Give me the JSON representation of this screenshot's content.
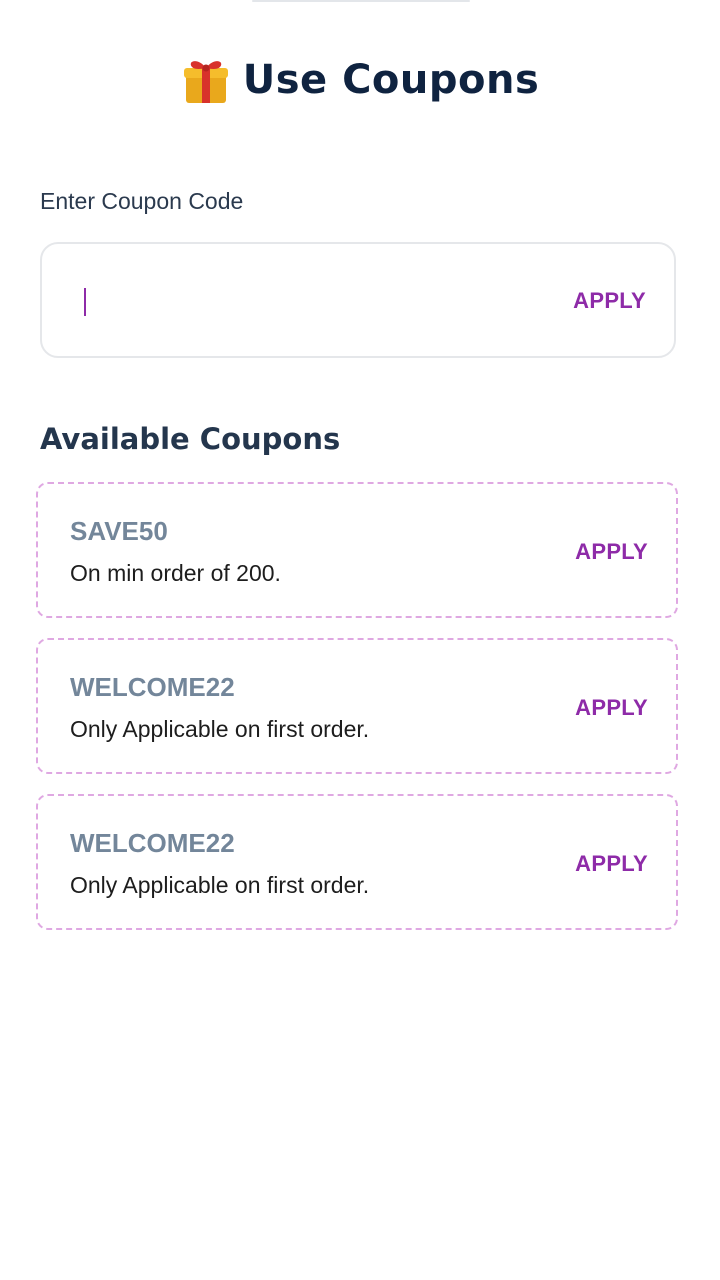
{
  "header": {
    "title": "Use Coupons",
    "icon": "gift-icon"
  },
  "coupon_input": {
    "label": "Enter Coupon Code",
    "value": "",
    "placeholder": "",
    "apply_label": "APPLY"
  },
  "available": {
    "title": "Available Coupons",
    "coupons": [
      {
        "code": "SAVE50",
        "description": "On min order of 200.",
        "apply_label": "APPLY"
      },
      {
        "code": "WELCOME22",
        "description": "Only Applicable on first order.",
        "apply_label": "APPLY"
      },
      {
        "code": "WELCOME22",
        "description": "Only Applicable on first order.",
        "apply_label": "APPLY"
      }
    ]
  },
  "colors": {
    "accent": "#8e2ba8",
    "title": "#0f2340",
    "coupon_code": "#73869a",
    "card_border": "#dfa8e2"
  }
}
